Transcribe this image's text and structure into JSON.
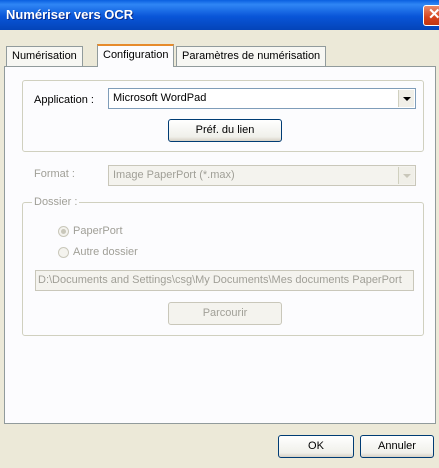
{
  "window": {
    "title": "Numériser vers OCR",
    "close_glyph": "✕"
  },
  "tabs": [
    {
      "label": "Numérisation"
    },
    {
      "label": "Configuration"
    },
    {
      "label": "Paramètres de numérisation"
    }
  ],
  "application": {
    "label": "Application :",
    "value": "Microsoft WordPad",
    "link_pref_button": "Préf. du lien"
  },
  "format": {
    "label": "Format :",
    "value": "Image PaperPort (*.max)"
  },
  "dossier": {
    "label": "Dossier :",
    "option_paperport": "PaperPort",
    "option_other": "Autre dossier",
    "path": "D:\\Documents and Settings\\csg\\My Documents\\Mes documents PaperPort",
    "browse_button": "Parcourir"
  },
  "footer": {
    "ok_button": "OK",
    "cancel_button": "Annuler"
  }
}
